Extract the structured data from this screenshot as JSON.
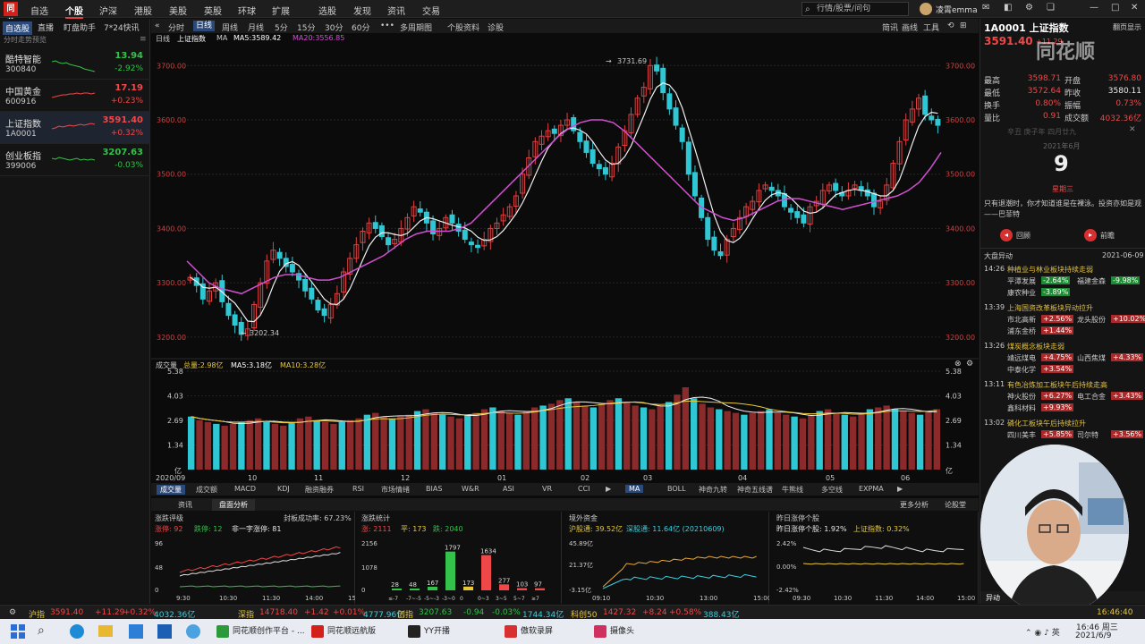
{
  "menu": {
    "logo": "同花",
    "items": [
      "自选",
      "个股",
      "沪深",
      "港股",
      "美股",
      "英股",
      "环球",
      "扩展",
      "选股",
      "发现",
      "资讯",
      "交易"
    ],
    "active_index": 1,
    "search_placeholder": "行情/股票/问句",
    "user": "凌霄emma",
    "window_controls": [
      "—",
      "□",
      "✕"
    ]
  },
  "left_panel": {
    "tabs": [
      "自选股",
      "直播",
      "盯盘助手",
      "7*24快讯"
    ],
    "subtitle": "分时走势预览",
    "stocks": [
      {
        "name": "酷特智能",
        "code": "300840",
        "price": "13.94",
        "change": "-2.92%",
        "dir": "down"
      },
      {
        "name": "中国黄金",
        "code": "600916",
        "price": "17.19",
        "change": "+0.23%",
        "dir": "up"
      },
      {
        "name": "上证指数",
        "code": "1A0001",
        "price": "3591.40",
        "change": "+0.32%",
        "dir": "up"
      },
      {
        "name": "创业板指",
        "code": "399006",
        "price": "3207.63",
        "change": "-0.03%",
        "dir": "down"
      }
    ]
  },
  "toolbar": {
    "items": [
      "分时",
      "日线",
      "周线",
      "月线",
      "5分",
      "15分",
      "30分",
      "60分",
      "•••",
      "多周期图",
      "个股资料",
      "诊股"
    ],
    "active_index": 1,
    "right_items": [
      "简讯",
      "画线",
      "工具"
    ]
  },
  "chart_header": {
    "period": "日线",
    "name": "上证指数",
    "ma_label": "MA",
    "ma5": "MA5:3589.42",
    "ma20": "MA20:3556.85"
  },
  "chart_data": {
    "type": "candlestick",
    "title": "上证指数",
    "y_ticks": [
      "3700.00",
      "3600.00",
      "3500.00",
      "3400.00",
      "3300.00",
      "3200.00"
    ],
    "ylim": [
      3180,
      3740
    ],
    "high_marker": "3731.69",
    "low_marker": "3202.34",
    "x_labels": [
      "2020/09",
      "10",
      "11",
      "12",
      "01",
      "02",
      "03",
      "04",
      "05",
      "06"
    ],
    "volume_header": {
      "label": "成交量",
      "total": "总量:2.98亿",
      "ma5": "MA5:3.18亿",
      "ma10": "MA10:3.28亿"
    },
    "volume_ticks": [
      "5.38",
      "4.03",
      "2.69",
      "1.34",
      "亿"
    ],
    "close_points": [
      3310,
      3295,
      3270,
      3285,
      3300,
      3265,
      3240,
      3222,
      3205,
      3215,
      3260,
      3300,
      3340,
      3360,
      3345,
      3330,
      3320,
      3305,
      3285,
      3270,
      3250,
      3240,
      3260,
      3280,
      3320,
      3345,
      3370,
      3395,
      3410,
      3400,
      3385,
      3370,
      3380,
      3400,
      3420,
      3440,
      3430,
      3410,
      3390,
      3400,
      3420,
      3410,
      3395,
      3380,
      3370,
      3365,
      3380,
      3400,
      3410,
      3425,
      3440,
      3460,
      3500,
      3530,
      3560,
      3570,
      3580,
      3575,
      3590,
      3600,
      3580,
      3560,
      3540,
      3520,
      3510,
      3500,
      3520,
      3550,
      3580,
      3610,
      3640,
      3660,
      3700,
      3690,
      3650,
      3620,
      3590,
      3560,
      3500,
      3460,
      3420,
      3380,
      3360,
      3350,
      3380,
      3400,
      3420,
      3440,
      3450,
      3470,
      3480,
      3470,
      3460,
      3440,
      3430,
      3420,
      3410,
      3440,
      3450,
      3470,
      3480,
      3470,
      3460,
      3470,
      3480,
      3470,
      3460,
      3440,
      3450,
      3480,
      3520,
      3560,
      3600,
      3620,
      3640,
      3610,
      3600,
      3590
    ],
    "ma20_points": [
      3340,
      3320,
      3300,
      3290,
      3285,
      3280,
      3290,
      3300,
      3310,
      3315,
      3315,
      3310,
      3305,
      3305,
      3310,
      3320,
      3330,
      3340,
      3350,
      3365,
      3380,
      3390,
      3395,
      3395,
      3395,
      3400,
      3410,
      3430,
      3450,
      3470,
      3490,
      3510,
      3530,
      3550,
      3570,
      3585,
      3595,
      3600,
      3600,
      3595,
      3580,
      3560,
      3540,
      3520,
      3500,
      3480,
      3460,
      3440,
      3430,
      3420,
      3415,
      3420,
      3430,
      3440,
      3450,
      3455,
      3455,
      3450,
      3445,
      3440,
      3435,
      3440,
      3445,
      3450,
      3455,
      3460,
      3470,
      3485,
      3510,
      3540
    ],
    "volumes": [
      2.9,
      2.7,
      2.6,
      2.5,
      2.4,
      2.5,
      2.6,
      2.7,
      2.8,
      2.6,
      2.5,
      2.4,
      2.6,
      2.8,
      2.9,
      2.7,
      2.6,
      2.5,
      2.6,
      2.7,
      2.8,
      3.0,
      3.1,
      2.9,
      2.8,
      2.9,
      3.0,
      3.2,
      3.3,
      3.1,
      3.0,
      2.9,
      2.8,
      3.0,
      3.1,
      3.3,
      3.4,
      3.2,
      3.1,
      3.0,
      3.2,
      3.4,
      3.5,
      3.6,
      3.8,
      3.9,
      3.7,
      3.5,
      3.4,
      3.6,
      3.8,
      3.9,
      3.7,
      3.5,
      3.4,
      3.3,
      3.5,
      3.7,
      4.1,
      4.5,
      3.9,
      3.6,
      3.4,
      3.3,
      3.2,
      3.1,
      3.0,
      3.1,
      3.2,
      3.3,
      3.1,
      3.0,
      2.9,
      2.8,
      3.0,
      3.2,
      3.3,
      3.1,
      3.0,
      2.9,
      3.1,
      3.3,
      3.4,
      3.5,
      3.3,
      3.2,
      3.1,
      3.0,
      3.2,
      3.3
    ],
    "grid": true
  },
  "indicator_tabs": {
    "left": [
      "成交量",
      "成交额",
      "MACD",
      "KDJ",
      "融资融券",
      "RSI",
      "市场情绪",
      "BIAS",
      "W&R",
      "ASI",
      "VR",
      "CCI"
    ],
    "right": [
      "MA",
      "BOLL",
      "神奇九转",
      "神奇五线谱",
      "牛熊线",
      "多空线",
      "EXPMA"
    ]
  },
  "bottom_tabs": {
    "items": [
      "资讯",
      "盘面分析"
    ],
    "active_index": 1,
    "right": [
      "更多分析",
      "论股堂"
    ]
  },
  "bottom_panels": {
    "p1": {
      "title": "涨跌评级",
      "sub": "封板成功率: 67.23%",
      "legend": [
        "涨停: 92",
        "跌停: 12",
        "非一字涨停: 81"
      ],
      "yticks": [
        "96",
        "48",
        "0"
      ],
      "xticks": [
        "9:30",
        "10:30",
        "11:30",
        "14:00",
        "15:00"
      ]
    },
    "p2": {
      "title": "涨跌统计",
      "legend": [
        "涨: 2111",
        "平: 173",
        "跌: 2040"
      ],
      "yticks": [
        "2156",
        "1078",
        "0"
      ],
      "bars": [
        {
          "v": 28,
          "c": "#33c24a"
        },
        {
          "v": 48,
          "c": "#33c24a"
        },
        {
          "v": 167,
          "c": "#33c24a"
        },
        {
          "v": 1797,
          "c": "#33c24a"
        },
        {
          "v": 173,
          "c": "#e8c838"
        },
        {
          "v": 1634,
          "c": "#f04848"
        },
        {
          "v": 277,
          "c": "#f04848"
        },
        {
          "v": 103,
          "c": "#f04848"
        },
        {
          "v": 97,
          "c": "#f04848"
        }
      ],
      "xticks": [
        "≤-7",
        "-7~-5",
        "-5~-3",
        "-3~0",
        "0",
        "0~3",
        "3~5",
        "5~7",
        "≥7"
      ]
    },
    "p3": {
      "title": "境外资金",
      "legend": [
        "沪股通: 39.52亿",
        "深股通: 11.64亿 (20210609)"
      ],
      "yticks": [
        "45.89亿",
        "21.37亿",
        "-3.15亿"
      ],
      "xticks": [
        "09:10",
        "10:30",
        "13:00",
        "15:00"
      ]
    },
    "p4": {
      "title": "昨日涨停个股",
      "legend": [
        "昨日涨停个股: 1.92%",
        "上证指数: 0.32%"
      ],
      "yticks": [
        "2.42%",
        "0.00%",
        "-2.42%"
      ],
      "xticks": [
        "09:30",
        "10:30",
        "11:30",
        "14:00",
        "15:00"
      ]
    }
  },
  "right_panel": {
    "title": "1A0001 上证指数",
    "top_right": "翻页显示",
    "price": "3591.40",
    "price_change": "+11.29",
    "stats": [
      {
        "l1": "最高",
        "v1": "3598.71",
        "c1": "red",
        "l2": "开盘",
        "v2": "3576.80",
        "c2": "red"
      },
      {
        "l1": "最低",
        "v1": "3572.64",
        "c1": "red",
        "l2": "昨收",
        "v2": "3580.11",
        "c2": "white"
      },
      {
        "l1": "换手",
        "v1": "0.80%",
        "c1": "red",
        "l2": "振幅",
        "v2": "0.73%",
        "c2": "red"
      },
      {
        "l1": "量比",
        "v1": "0.91",
        "c1": "red",
        "l2": "成交额",
        "v2": "4032.36亿",
        "c2": "red"
      }
    ],
    "calendar_hint": "辛丑 庚子年 四月廿九",
    "calendar_month": "2021年6月",
    "calendar_day": "9",
    "calendar_weekday": "星期三",
    "quote": "只有退潮时，你才知道谁是在裸泳。投资亦如是观——巴菲特",
    "buttons": [
      "回顾",
      "前瞻"
    ],
    "events_title": "大盘异动",
    "events_date": "2021-06-09",
    "events": [
      {
        "time": "14:26",
        "title": "种植业与林业板块持续走弱",
        "stocks": [
          [
            "平潭发展",
            "-2.64%",
            "down"
          ],
          [
            "福建金森",
            "-9.98%",
            "down"
          ],
          [
            "康农种业",
            "-3.89%",
            "down"
          ]
        ]
      },
      {
        "time": "13:39",
        "title": "上海国资改革板块异动拉升",
        "stocks": [
          [
            "市北高新",
            "+2.56%",
            "up"
          ],
          [
            "龙头股份",
            "+10.02%",
            "up"
          ],
          [
            "浦东金桥",
            "+1.44%",
            "up"
          ]
        ]
      },
      {
        "time": "13:26",
        "title": "煤炭概念板块走弱",
        "stocks": [
          [
            "靖远煤电",
            "+4.75%",
            "up"
          ],
          [
            "山西焦煤",
            "+4.33%",
            "up"
          ],
          [
            "中泰化学",
            "+3.54%",
            "up"
          ]
        ]
      },
      {
        "time": "13:11",
        "title": "有色冶炼加工板块午后持续走高",
        "stocks": [
          [
            "神火股份",
            "+6.27%",
            "up"
          ],
          [
            "电工合金",
            "+3.43%",
            "up"
          ],
          [
            "鑫科材料",
            "+9.93%",
            "up"
          ]
        ]
      },
      {
        "time": "13:02",
        "title": "磷化工板块午后持续拉升",
        "stocks": [
          [
            "四川美丰",
            "+5.85%",
            "up"
          ],
          [
            "司尔特",
            "+3.56%",
            "up"
          ]
        ]
      }
    ],
    "bottom_tab": "异动",
    "watermark": "同花顺"
  },
  "status_bar": [
    {
      "label": "沪指",
      "price": "3591.40",
      "chg": "+11.29",
      "pct": "+0.32%",
      "amt": "4032.36亿",
      "dir": "up"
    },
    {
      "label": "深指",
      "price": "14718.40",
      "chg": "+1.42",
      "pct": "+0.01%",
      "amt": "4777.96亿",
      "dir": "up"
    },
    {
      "label": "创指",
      "price": "3207.63",
      "chg": "-0.94",
      "pct": "-0.03%",
      "amt": "1744.34亿",
      "dir": "down"
    },
    {
      "label": "科创50",
      "price": "1427.32",
      "chg": "+8.24",
      "pct": "+0.58%",
      "amt": "388.43亿",
      "dir": "up"
    }
  ],
  "status_time": "16:46:40",
  "taskbar": {
    "items": [
      "同花顺创作平台 - ...",
      "同花顺远航版",
      "YY开播",
      "傲软录屏",
      "摄像头"
    ],
    "time": "16:46 周三",
    "date": "2021/6/9"
  }
}
